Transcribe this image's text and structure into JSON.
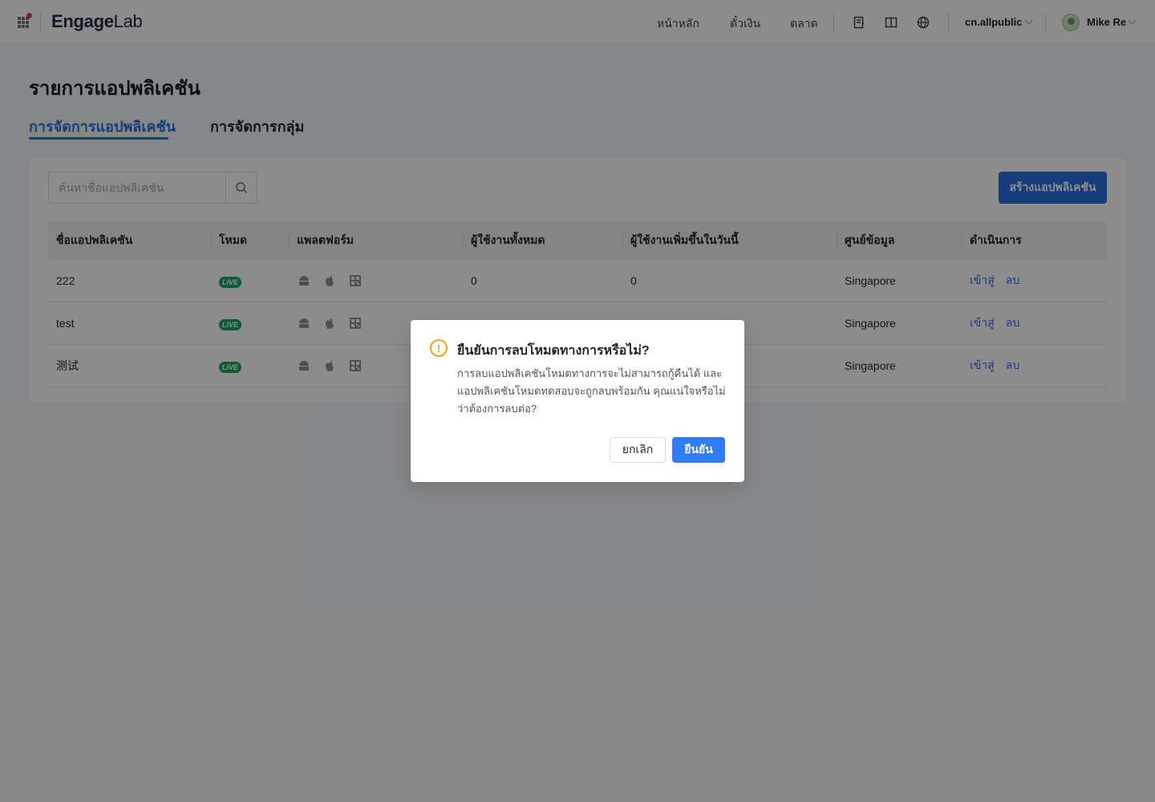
{
  "header": {
    "brand": "EngageLab",
    "nav": [
      "หน้าหลัก",
      "ตั๋วเงิน",
      "ตลาด"
    ],
    "account": "cn.allpublic",
    "username": "Mike Re"
  },
  "page": {
    "title": "รายการแอปพลิเคชัน",
    "tabs": [
      {
        "label": "การจัดการแอปพลิเคชัน",
        "active": true
      },
      {
        "label": "การจัดการกลุ่ม",
        "active": false
      }
    ]
  },
  "toolbar": {
    "search_placeholder": "ค้นหาชื่อแอปพลิเคชัน",
    "create_label": "สร้างแอปพลิเคชัน"
  },
  "table": {
    "columns": [
      "ชื่อแอปพลิเคชัน",
      "โหมด",
      "แพลตฟอร์ม",
      "ผู้ใช้งานทั้งหมด",
      "ผู้ใช้งานเพิ่มขึ้นในวันนี้",
      "ศูนย์ข้อมูล",
      "ดำเนินการ"
    ],
    "rows": [
      {
        "name": "222",
        "mode": "LIVE",
        "total": "0",
        "today": "0",
        "datacenter": "Singapore",
        "enter": "เข้าสู่",
        "delete": "ลบ"
      },
      {
        "name": "test",
        "mode": "LIVE",
        "total": "",
        "today": "",
        "datacenter": "Singapore",
        "enter": "เข้าสู่",
        "delete": "ลบ"
      },
      {
        "name": "测试",
        "mode": "LIVE",
        "total": "",
        "today": "",
        "datacenter": "Singapore",
        "enter": "เข้าสู่",
        "delete": "ลบ"
      }
    ]
  },
  "modal": {
    "title": "ยืนยันการลบโหมดทางการหรือไม่?",
    "body": "การลบแอปพลิเคชันโหมดทางการจะไม่สามารถกู้คืนได้ และแอปพลิเคชันโหมดทดสอบจะถูกลบพร้อมกัน คุณแน่ใจหรือไม่ว่าต้องการลบต่อ?",
    "cancel": "ยกเลิก",
    "confirm": "ยืนยัน"
  },
  "colors": {
    "accent": "#2a6ee0",
    "live": "#19a562",
    "warning": "#f0a020"
  }
}
